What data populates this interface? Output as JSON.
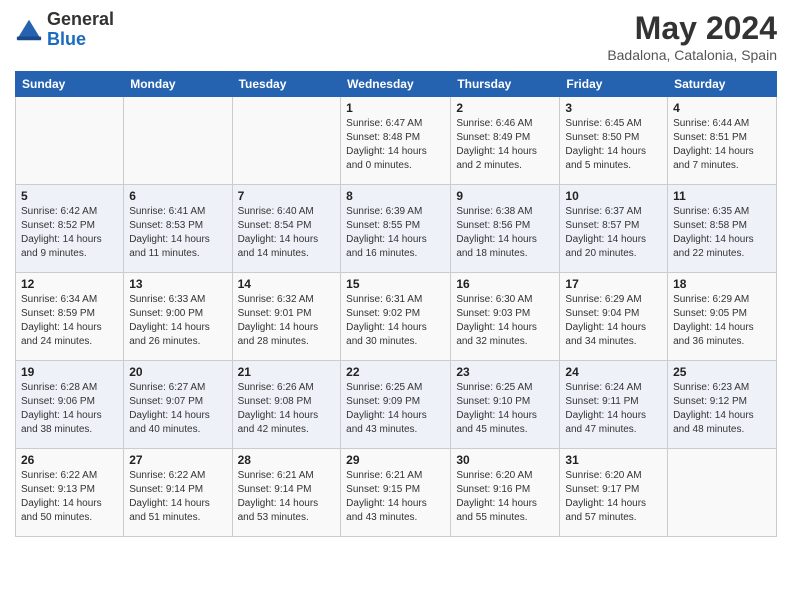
{
  "logo": {
    "general": "General",
    "blue": "Blue"
  },
  "header": {
    "month_year": "May 2024",
    "location": "Badalona, Catalonia, Spain"
  },
  "days_of_week": [
    "Sunday",
    "Monday",
    "Tuesday",
    "Wednesday",
    "Thursday",
    "Friday",
    "Saturday"
  ],
  "weeks": [
    [
      {
        "day": "",
        "sunrise": "",
        "sunset": "",
        "daylight": ""
      },
      {
        "day": "",
        "sunrise": "",
        "sunset": "",
        "daylight": ""
      },
      {
        "day": "",
        "sunrise": "",
        "sunset": "",
        "daylight": ""
      },
      {
        "day": "1",
        "sunrise": "Sunrise: 6:47 AM",
        "sunset": "Sunset: 8:48 PM",
        "daylight": "Daylight: 14 hours and 0 minutes."
      },
      {
        "day": "2",
        "sunrise": "Sunrise: 6:46 AM",
        "sunset": "Sunset: 8:49 PM",
        "daylight": "Daylight: 14 hours and 2 minutes."
      },
      {
        "day": "3",
        "sunrise": "Sunrise: 6:45 AM",
        "sunset": "Sunset: 8:50 PM",
        "daylight": "Daylight: 14 hours and 5 minutes."
      },
      {
        "day": "4",
        "sunrise": "Sunrise: 6:44 AM",
        "sunset": "Sunset: 8:51 PM",
        "daylight": "Daylight: 14 hours and 7 minutes."
      }
    ],
    [
      {
        "day": "5",
        "sunrise": "Sunrise: 6:42 AM",
        "sunset": "Sunset: 8:52 PM",
        "daylight": "Daylight: 14 hours and 9 minutes."
      },
      {
        "day": "6",
        "sunrise": "Sunrise: 6:41 AM",
        "sunset": "Sunset: 8:53 PM",
        "daylight": "Daylight: 14 hours and 11 minutes."
      },
      {
        "day": "7",
        "sunrise": "Sunrise: 6:40 AM",
        "sunset": "Sunset: 8:54 PM",
        "daylight": "Daylight: 14 hours and 14 minutes."
      },
      {
        "day": "8",
        "sunrise": "Sunrise: 6:39 AM",
        "sunset": "Sunset: 8:55 PM",
        "daylight": "Daylight: 14 hours and 16 minutes."
      },
      {
        "day": "9",
        "sunrise": "Sunrise: 6:38 AM",
        "sunset": "Sunset: 8:56 PM",
        "daylight": "Daylight: 14 hours and 18 minutes."
      },
      {
        "day": "10",
        "sunrise": "Sunrise: 6:37 AM",
        "sunset": "Sunset: 8:57 PM",
        "daylight": "Daylight: 14 hours and 20 minutes."
      },
      {
        "day": "11",
        "sunrise": "Sunrise: 6:35 AM",
        "sunset": "Sunset: 8:58 PM",
        "daylight": "Daylight: 14 hours and 22 minutes."
      }
    ],
    [
      {
        "day": "12",
        "sunrise": "Sunrise: 6:34 AM",
        "sunset": "Sunset: 8:59 PM",
        "daylight": "Daylight: 14 hours and 24 minutes."
      },
      {
        "day": "13",
        "sunrise": "Sunrise: 6:33 AM",
        "sunset": "Sunset: 9:00 PM",
        "daylight": "Daylight: 14 hours and 26 minutes."
      },
      {
        "day": "14",
        "sunrise": "Sunrise: 6:32 AM",
        "sunset": "Sunset: 9:01 PM",
        "daylight": "Daylight: 14 hours and 28 minutes."
      },
      {
        "day": "15",
        "sunrise": "Sunrise: 6:31 AM",
        "sunset": "Sunset: 9:02 PM",
        "daylight": "Daylight: 14 hours and 30 minutes."
      },
      {
        "day": "16",
        "sunrise": "Sunrise: 6:30 AM",
        "sunset": "Sunset: 9:03 PM",
        "daylight": "Daylight: 14 hours and 32 minutes."
      },
      {
        "day": "17",
        "sunrise": "Sunrise: 6:29 AM",
        "sunset": "Sunset: 9:04 PM",
        "daylight": "Daylight: 14 hours and 34 minutes."
      },
      {
        "day": "18",
        "sunrise": "Sunrise: 6:29 AM",
        "sunset": "Sunset: 9:05 PM",
        "daylight": "Daylight: 14 hours and 36 minutes."
      }
    ],
    [
      {
        "day": "19",
        "sunrise": "Sunrise: 6:28 AM",
        "sunset": "Sunset: 9:06 PM",
        "daylight": "Daylight: 14 hours and 38 minutes."
      },
      {
        "day": "20",
        "sunrise": "Sunrise: 6:27 AM",
        "sunset": "Sunset: 9:07 PM",
        "daylight": "Daylight: 14 hours and 40 minutes."
      },
      {
        "day": "21",
        "sunrise": "Sunrise: 6:26 AM",
        "sunset": "Sunset: 9:08 PM",
        "daylight": "Daylight: 14 hours and 42 minutes."
      },
      {
        "day": "22",
        "sunrise": "Sunrise: 6:25 AM",
        "sunset": "Sunset: 9:09 PM",
        "daylight": "Daylight: 14 hours and 43 minutes."
      },
      {
        "day": "23",
        "sunrise": "Sunrise: 6:25 AM",
        "sunset": "Sunset: 9:10 PM",
        "daylight": "Daylight: 14 hours and 45 minutes."
      },
      {
        "day": "24",
        "sunrise": "Sunrise: 6:24 AM",
        "sunset": "Sunset: 9:11 PM",
        "daylight": "Daylight: 14 hours and 47 minutes."
      },
      {
        "day": "25",
        "sunrise": "Sunrise: 6:23 AM",
        "sunset": "Sunset: 9:12 PM",
        "daylight": "Daylight: 14 hours and 48 minutes."
      }
    ],
    [
      {
        "day": "26",
        "sunrise": "Sunrise: 6:22 AM",
        "sunset": "Sunset: 9:13 PM",
        "daylight": "Daylight: 14 hours and 50 minutes."
      },
      {
        "day": "27",
        "sunrise": "Sunrise: 6:22 AM",
        "sunset": "Sunset: 9:14 PM",
        "daylight": "Daylight: 14 hours and 51 minutes."
      },
      {
        "day": "28",
        "sunrise": "Sunrise: 6:21 AM",
        "sunset": "Sunset: 9:14 PM",
        "daylight": "Daylight: 14 hours and 53 minutes."
      },
      {
        "day": "29",
        "sunrise": "Sunrise: 6:21 AM",
        "sunset": "Sunset: 9:15 PM",
        "daylight": "Daylight: 14 hours and 43 minutes."
      },
      {
        "day": "30",
        "sunrise": "Sunrise: 6:20 AM",
        "sunset": "Sunset: 9:16 PM",
        "daylight": "Daylight: 14 hours and 55 minutes."
      },
      {
        "day": "31",
        "sunrise": "Sunrise: 6:20 AM",
        "sunset": "Sunset: 9:17 PM",
        "daylight": "Daylight: 14 hours and 57 minutes."
      },
      {
        "day": "",
        "sunrise": "",
        "sunset": "",
        "daylight": ""
      }
    ]
  ]
}
